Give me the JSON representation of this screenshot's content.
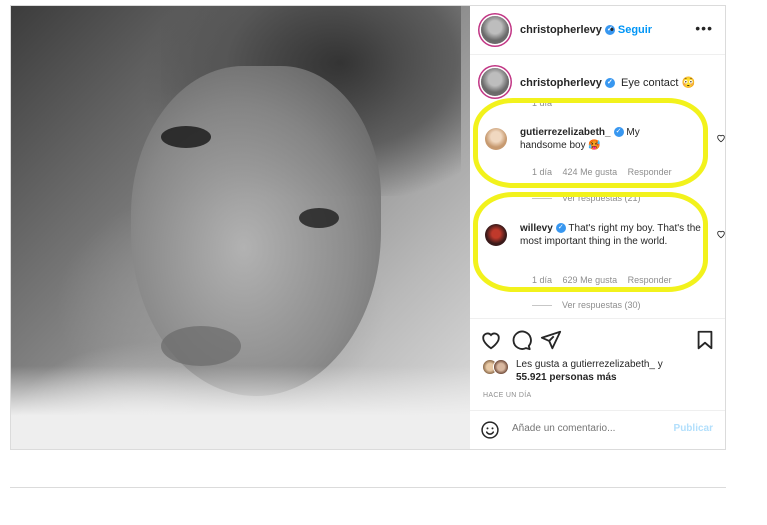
{
  "post": {
    "author": "christopherlevy",
    "follow_label": "Seguir",
    "more_icon": "more-horizontal-icon",
    "caption": {
      "username": "christopherlevy",
      "text": "Eye contact 😳",
      "time": "1 día"
    },
    "comments": [
      {
        "username": "gutierrezelizabeth_",
        "text": "My handsome boy 🥵",
        "time": "1 día",
        "likes": "424 Me gusta",
        "reply_label": "Responder",
        "view_replies": "Ver respuestas (21)"
      },
      {
        "username": "willevy",
        "text": "That's right my boy. That's the most important thing in the world.",
        "time": "1 día",
        "likes": "629 Me gusta",
        "reply_label": "Responder",
        "view_replies": "Ver respuestas (30)"
      }
    ],
    "likes_line1": "Les gusta a gutierrezelizabeth_ y",
    "likes_line2": "55.921 personas más",
    "posted_when": "HACE UN DÍA",
    "comment_placeholder": "Añade un comentario...",
    "publish_label": "Publicar",
    "colors": {
      "link_blue": "#0095f6",
      "verified_blue": "#3897f0",
      "highlight_yellow": "#f2f21c",
      "publish_disabled": "#b2dffc"
    }
  }
}
